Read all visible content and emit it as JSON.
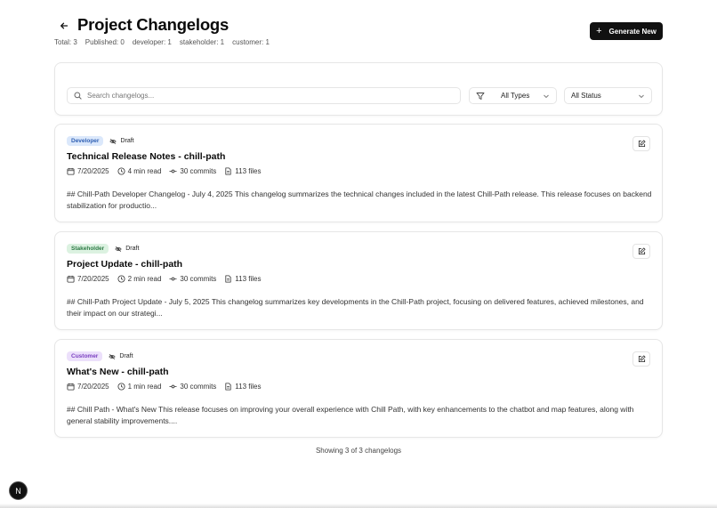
{
  "header": {
    "title": "Project Changelogs",
    "generate_label": "Generate New",
    "stats": [
      "Total: 3",
      "Published: 0",
      "developer: 1",
      "stakeholder: 1",
      "customer: 1"
    ]
  },
  "filters": {
    "search_placeholder": "Search changelogs...",
    "type_value": "All Types",
    "status_value": "All Status"
  },
  "changelogs": [
    {
      "type": "Developer",
      "status": "Draft",
      "title": "Technical Release Notes - chill-path",
      "date": "7/20/2025",
      "read_time": "4 min read",
      "commits": "30 commits",
      "files": "113 files",
      "excerpt": "## Chill-Path Developer Changelog - July 4, 2025 This changelog summarizes the technical changes included in the latest Chill-Path release. This release focuses on backend stabilization for productio...",
      "badge_bg": "#dbe8fb",
      "badge_fg": "#2f5fb3"
    },
    {
      "type": "Stakeholder",
      "status": "Draft",
      "title": "Project Update - chill-path",
      "date": "7/20/2025",
      "read_time": "2 min read",
      "commits": "30 commits",
      "files": "113 files",
      "excerpt": "## Chill-Path Project Update - July 5, 2025 This changelog summarizes key developments in the Chill-Path project, focusing on delivered features, achieved milestones, and their impact on our strategi...",
      "badge_bg": "#dcf2e1",
      "badge_fg": "#2c7a44"
    },
    {
      "type": "Customer",
      "status": "Draft",
      "title": "What's New - chill-path",
      "date": "7/20/2025",
      "read_time": "1 min read",
      "commits": "30 commits",
      "files": "113 files",
      "excerpt": "## Chill Path - What's New This release focuses on improving your overall experience with Chill Path, with key enhancements to the chatbot and map features, along with general stability improvements....",
      "badge_bg": "#ece0fb",
      "badge_fg": "#7a3fc0"
    }
  ],
  "footer": {
    "showing": "Showing 3 of 3 changelogs"
  },
  "dev_badge": {
    "letter": "N"
  }
}
